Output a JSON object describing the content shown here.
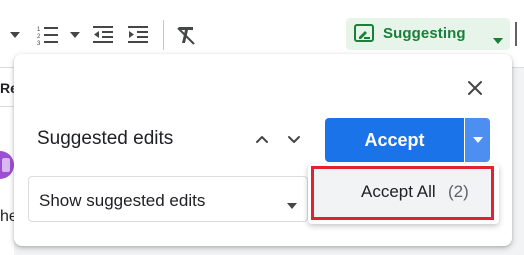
{
  "toolbar": {
    "mode_label": "Suggesting",
    "icons": [
      "dropdown-caret-icon",
      "numbered-list-icon",
      "dropdown-caret-icon",
      "decrease-indent-icon",
      "increase-indent-icon",
      "clear-formatting-icon",
      "suggest-edit-icon"
    ]
  },
  "document": {
    "fragment_top": "Re",
    "fragment_bottom": "he"
  },
  "panel": {
    "title": "Suggested edits",
    "accept_label": "Accept",
    "view_select_value": "Show suggested edits"
  },
  "menu": {
    "accept_all_label": "Accept All",
    "accept_all_count": "(2)"
  },
  "colors": {
    "accent_blue": "#1a73e8",
    "suggesting_green": "#188038",
    "suggesting_bg": "#e6f4ea",
    "highlight_red": "#e0242f"
  }
}
